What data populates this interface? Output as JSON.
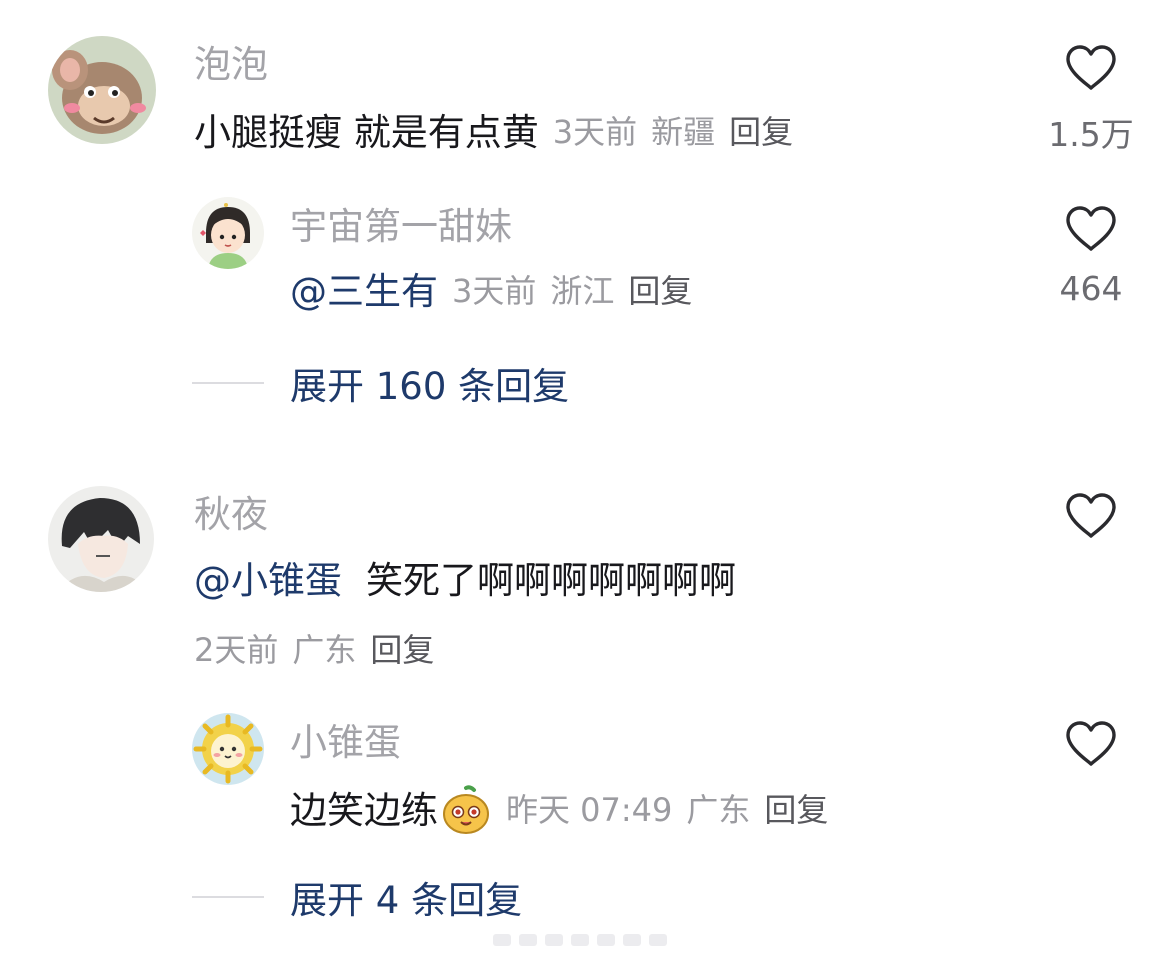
{
  "comments": [
    {
      "username": "泡泡",
      "text": "小腿挺瘦 就是有点黄",
      "time": "3天前",
      "location": "新疆",
      "reply_label": "回复",
      "likes": "1.5万",
      "avatar_icon": "cartoon-mouse-avatar",
      "replies": [
        {
          "username": "宇宙第一甜妹",
          "mention": "@三生有",
          "time": "3天前",
          "location": "浙江",
          "reply_label": "回复",
          "likes": "464",
          "avatar_icon": "cartoon-girl-avatar"
        }
      ],
      "expand_label": "展开 160 条回复"
    },
    {
      "username": "秋夜",
      "mention": "@小锥蛋",
      "text": "笑死了啊啊啊啊啊啊啊",
      "time": "2天前",
      "location": "广东",
      "reply_label": "回复",
      "avatar_icon": "anime-boy-avatar",
      "replies": [
        {
          "username": "小锥蛋",
          "text": "边笑边练",
          "emoji_icon": "smiling-blob-emoji",
          "time": "昨天 07:49",
          "location": "广东",
          "reply_label": "回复",
          "avatar_icon": "sun-avatar"
        }
      ],
      "expand_label": "展开 4 条回复"
    }
  ],
  "colors": {
    "username": "#a3a3a8",
    "text": "#18181c",
    "mention": "#1e3a6b",
    "meta": "#9b9ba0"
  }
}
